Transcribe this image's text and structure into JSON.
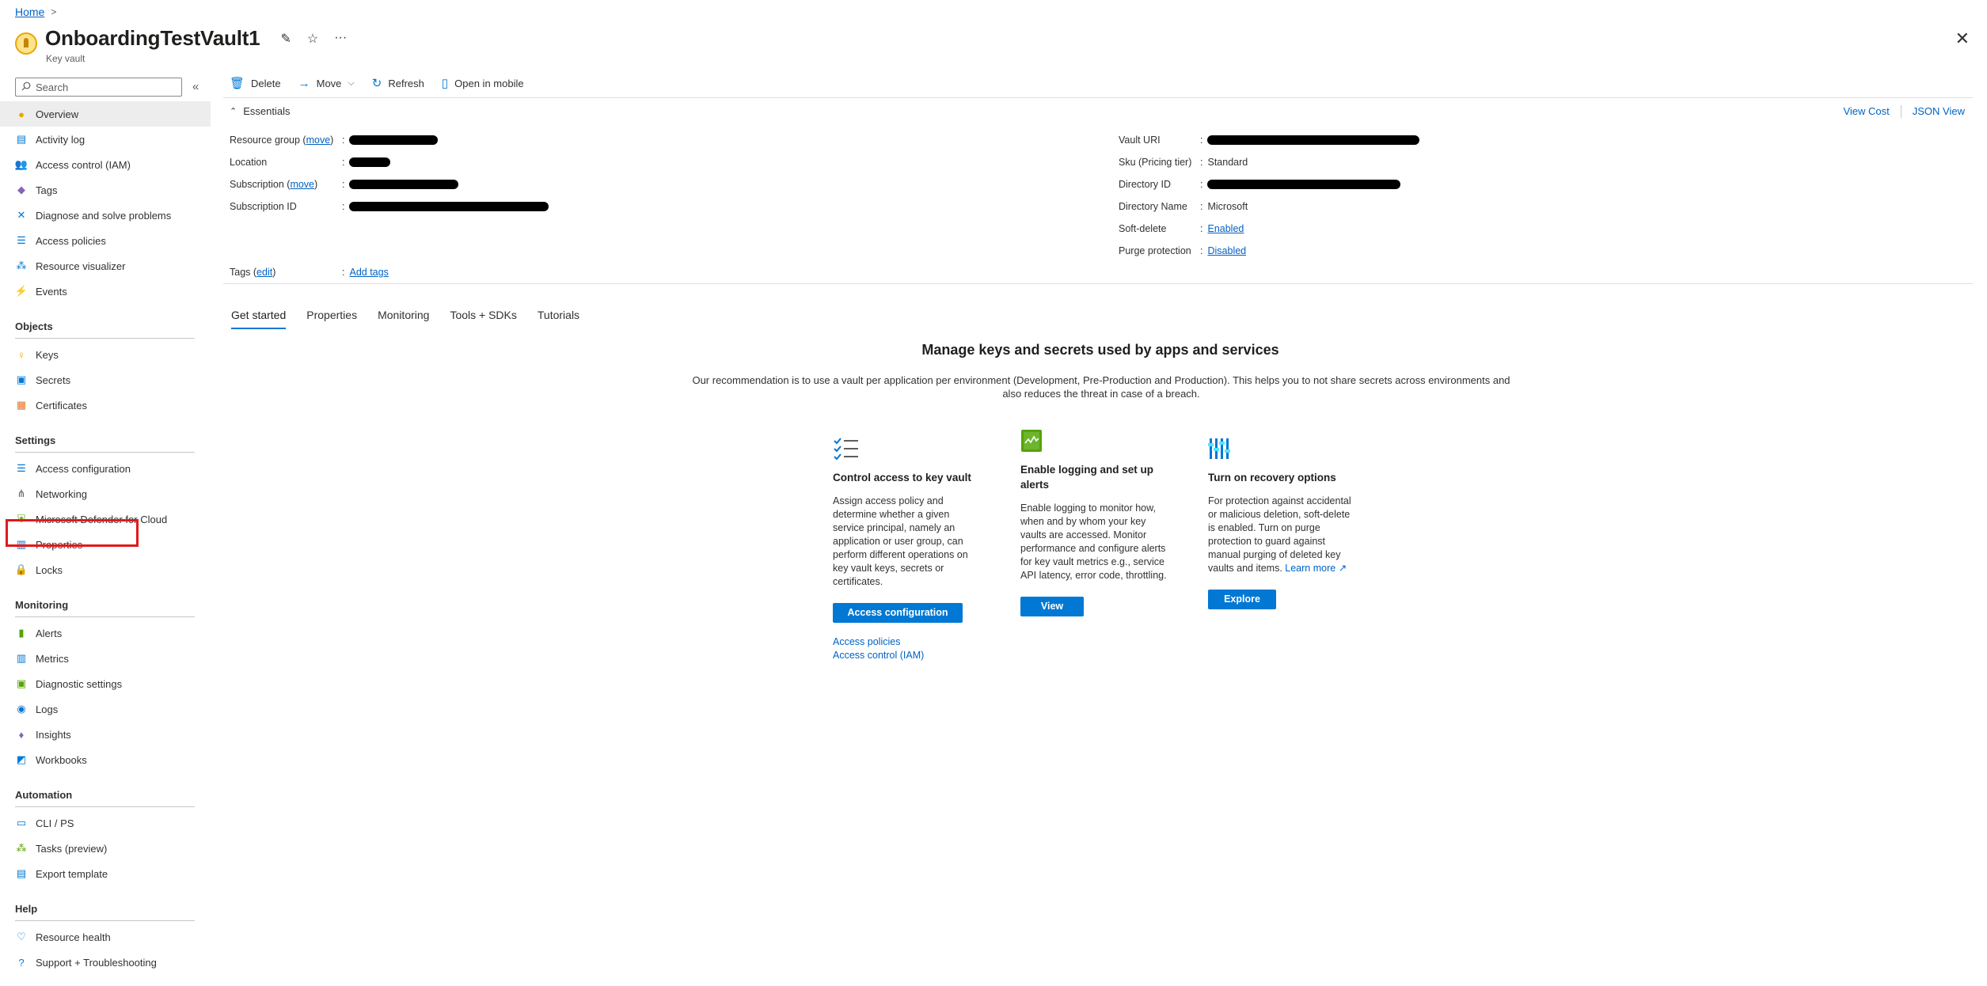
{
  "breadcrumb": {
    "home": "Home",
    "sep": ">"
  },
  "header": {
    "title": "OnboardingTestVault1",
    "subtitle": "Key vault",
    "pin": "✎",
    "star": "☆",
    "more": "···",
    "close": "✕"
  },
  "sidebar": {
    "search_placeholder": "Search",
    "collapse": "«",
    "items": [
      {
        "label": "Overview",
        "icon": "key-vault-icon",
        "glyph": "●",
        "color": "#e8a700"
      },
      {
        "label": "Activity log",
        "icon": "activity-log-icon",
        "glyph": "▤",
        "color": "#0078d4"
      },
      {
        "label": "Access control (IAM)",
        "icon": "iam-icon",
        "glyph": "👥",
        "color": "#0078d4"
      },
      {
        "label": "Tags",
        "icon": "tag-icon",
        "glyph": "◆",
        "color": "#8764b8"
      },
      {
        "label": "Diagnose and solve problems",
        "icon": "diagnose-icon",
        "glyph": "✕",
        "color": "#0078d4"
      },
      {
        "label": "Access policies",
        "icon": "access-policies-icon",
        "glyph": "☰",
        "color": "#0078d4"
      },
      {
        "label": "Resource visualizer",
        "icon": "resource-visualizer-icon",
        "glyph": "⁂",
        "color": "#0078d4"
      },
      {
        "label": "Events",
        "icon": "events-icon",
        "glyph": "⚡",
        "color": "#f2c811"
      }
    ],
    "sections": [
      {
        "title": "Objects",
        "items": [
          {
            "label": "Keys",
            "icon": "key-icon",
            "glyph": "♀",
            "color": "#e8a700"
          },
          {
            "label": "Secrets",
            "icon": "secrets-icon",
            "glyph": "▣",
            "color": "#0078d4"
          },
          {
            "label": "Certificates",
            "icon": "certificate-icon",
            "glyph": "▦",
            "color": "#e8732a"
          }
        ]
      },
      {
        "title": "Settings",
        "items": [
          {
            "label": "Access configuration",
            "icon": "access-configuration-icon",
            "glyph": "☰",
            "color": "#0078d4"
          },
          {
            "label": "Networking",
            "icon": "networking-icon",
            "glyph": "⋔",
            "color": "#605e5c"
          },
          {
            "label": "Microsoft Defender for Cloud",
            "icon": "defender-shield-icon",
            "glyph": "⛨",
            "color": "#57a300"
          },
          {
            "label": "Properties",
            "icon": "properties-icon",
            "glyph": "▥",
            "color": "#0078d4"
          },
          {
            "label": "Locks",
            "icon": "lock-icon",
            "glyph": "🔒",
            "color": "#0078d4"
          }
        ]
      },
      {
        "title": "Monitoring",
        "items": [
          {
            "label": "Alerts",
            "icon": "alerts-icon",
            "glyph": "▮",
            "color": "#57a300"
          },
          {
            "label": "Metrics",
            "icon": "metrics-icon",
            "glyph": "▥",
            "color": "#0078d4"
          },
          {
            "label": "Diagnostic settings",
            "icon": "diagnostic-settings-icon",
            "glyph": "▣",
            "color": "#57a300"
          },
          {
            "label": "Logs",
            "icon": "logs-icon",
            "glyph": "◉",
            "color": "#0078d4"
          },
          {
            "label": "Insights",
            "icon": "insights-icon",
            "glyph": "♦",
            "color": "#8764b8"
          },
          {
            "label": "Workbooks",
            "icon": "workbooks-icon",
            "glyph": "◩",
            "color": "#0078d4"
          }
        ]
      },
      {
        "title": "Automation",
        "items": [
          {
            "label": "CLI / PS",
            "icon": "cli-icon",
            "glyph": "▭",
            "color": "#0078d4"
          },
          {
            "label": "Tasks (preview)",
            "icon": "tasks-icon",
            "glyph": "⁂",
            "color": "#57a300"
          },
          {
            "label": "Export template",
            "icon": "export-template-icon",
            "glyph": "▤",
            "color": "#0078d4"
          }
        ]
      },
      {
        "title": "Help",
        "items": [
          {
            "label": "Resource health",
            "icon": "resource-health-icon",
            "glyph": "♡",
            "color": "#0078d4"
          },
          {
            "label": "Support + Troubleshooting",
            "icon": "support-icon",
            "glyph": "?",
            "color": "#0078d4"
          }
        ]
      }
    ]
  },
  "toolbar": {
    "delete": "Delete",
    "move": "Move",
    "refresh": "Refresh",
    "open_mobile": "Open in mobile"
  },
  "essentials": {
    "title": "Essentials",
    "view_cost": "View Cost",
    "json_view": "JSON View",
    "resource_group_label": "Resource group",
    "move": "move",
    "location_label": "Location",
    "subscription_label": "Subscription",
    "subscription_id_label": "Subscription ID",
    "vault_uri_label": "Vault URI",
    "sku_label": "Sku (Pricing tier)",
    "sku_value": "Standard",
    "directory_id_label": "Directory ID",
    "directory_name_label": "Directory Name",
    "directory_name_value": "Microsoft",
    "soft_delete_label": "Soft-delete",
    "soft_delete_value": "Enabled",
    "purge_label": "Purge protection",
    "purge_value": "Disabled",
    "tags_label": "Tags",
    "tags_edit": "edit",
    "add_tags": "Add tags"
  },
  "tabs": [
    "Get started",
    "Properties",
    "Monitoring",
    "Tools + SDKs",
    "Tutorials"
  ],
  "main": {
    "heading": "Manage keys and secrets used by apps and services",
    "description": "Our recommendation is to use a vault per application per environment (Development, Pre-Production and Production). This helps you to not share secrets across environments and also reduces the threat in case of a breach."
  },
  "cards": {
    "access": {
      "title": "Control access to key vault",
      "body": "Assign access policy and determine whether a given service principal, namely an application or user group, can perform different operations on key vault keys, secrets or certificates.",
      "button": "Access configuration",
      "link1": "Access policies",
      "link2": "Access control (IAM)"
    },
    "logging": {
      "title": "Enable logging and set up alerts",
      "body": "Enable logging to monitor how, when and by whom your key vaults are accessed. Monitor performance and configure alerts for key vault metrics e.g., service API latency, error code, throttling.",
      "button": "View"
    },
    "recovery": {
      "title": "Turn on recovery options",
      "body": "For protection against accidental or malicious deletion, soft-delete is enabled. Turn on purge protection to guard against manual purging of deleted key vaults and items.",
      "learn_more": "Learn more",
      "button": "Explore"
    }
  }
}
